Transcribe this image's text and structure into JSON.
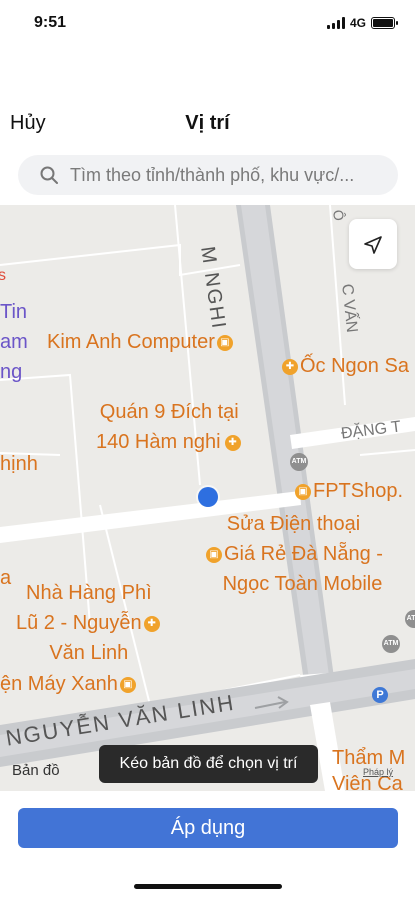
{
  "status_bar": {
    "time": "9:51",
    "network": "4G"
  },
  "header": {
    "cancel_label": "Hủy",
    "title": "Vị trí"
  },
  "search": {
    "placeholder": "Tìm theo tỉnh/thành phố, khu vực/..."
  },
  "map": {
    "streets": {
      "ham_nghi": "M NGHI",
      "dang": "ĐẶNG T",
      "nguyen_van_linh": "NGUYỄN VĂN LINH",
      "c_van": "C VẤN",
      "o": "Ô"
    },
    "pois": {
      "partial_tin": "Tin",
      "partial_am": "am",
      "partial_ng": "ng",
      "partial_hinh": "hịnh",
      "partial_a": "a",
      "kim_anh": "Kim Anh Computer",
      "oc_ngon": "Ốc Ngon Sa",
      "quan9_line1": "Quán 9 Đích tại",
      "quan9_line2": "140 Hàm nghi",
      "fptshop": "FPTShop.",
      "sua_line1": "Sửa Điện thoại",
      "sua_line2": "Giá Rẻ Đà Nẵng -",
      "sua_line3": "Ngọc Toàn Mobile",
      "nha_hang_line1": "Nhà Hàng Phì",
      "nha_hang_line2": "Lũ 2 - Nguyễn",
      "nha_hang_line3": "Văn Linh",
      "dien_may": "ện Máy Xanh",
      "tham_line1": "Thẩm M",
      "tham_line2": "Viện Ca"
    },
    "atm_label": "ATM",
    "parking_label": "P",
    "maps_logo": "Bản đồ",
    "legal": "Pháp lý",
    "drag_hint": "Kéo bản đồ để chọn vị trí"
  },
  "apply_label": "Áp dụng",
  "colors": {
    "primary": "#4274d6",
    "poi": "#d9741f",
    "pin": "#2e6fe0",
    "map_bg": "#ecebe8",
    "road": "#c9cbce"
  },
  "icons": [
    "signal-icon",
    "battery-icon",
    "search-icon",
    "locate-icon",
    "restaurant-icon",
    "shop-icon",
    "atm-icon",
    "parking-icon",
    "apple-logo-icon"
  ]
}
